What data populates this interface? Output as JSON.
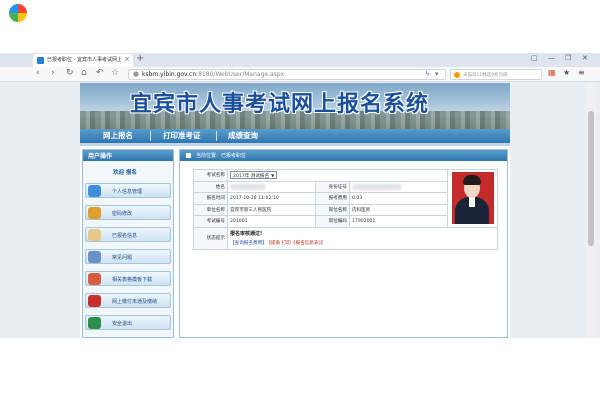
{
  "browser": {
    "tab": {
      "title": "已报考职位 - 宜宾市人事考试网上报名系统",
      "close": "×"
    },
    "new_tab": "+",
    "window_controls": {
      "menu": "▢",
      "minimize": "—",
      "restore": "❐",
      "close": "✕"
    },
    "nav": {
      "back": "‹",
      "forward": "›",
      "reload": "↻",
      "home": "⌂",
      "undo": "↶",
      "favorite": "☆"
    },
    "address": {
      "host": "ksbm.yibin.gov.cn",
      "path": ":8180/WebUser/Manage.aspx"
    },
    "address_icons": {
      "lightning": "ϟ",
      "dropdown": "▾"
    },
    "search": {
      "placeholder": "天猫双11精选9折包邮"
    },
    "toolbar_icons": {
      "apps": "▦",
      "star": "★",
      "menu": "≡"
    }
  },
  "site": {
    "banner_title": "宜宾市人事考试网上报名系统",
    "main_nav": [
      "网上报名",
      "打印准考证",
      "成绩查询"
    ]
  },
  "sidebar": {
    "header": "用户操作",
    "welcome": "欢迎 报名",
    "items": [
      {
        "label": "个人信息管理",
        "color": "#3f8ed8"
      },
      {
        "label": "密码修改",
        "color": "#e0a030"
      },
      {
        "label": "已报名信息",
        "color": "#e6c98a"
      },
      {
        "label": "常见问题",
        "color": "#6b8fc9"
      },
      {
        "label": "相关表格模板下载",
        "color": "#d95c40"
      },
      {
        "label": "网上缴付未通及缴纳",
        "color": "#c9302c"
      },
      {
        "label": "安全退出",
        "color": "#2d8f4e"
      }
    ]
  },
  "content": {
    "breadcrumb": "当前位置：已报考职位",
    "exam_label": "考试名称",
    "exam_value": "2017年 测试报名",
    "exam_dropdown": "▼",
    "rows": [
      {
        "k1": "姓名",
        "v1": "",
        "k2": "身份证号",
        "v2": ""
      },
      {
        "k1": "报名时间",
        "v1": "2017-10-28 11:02:10",
        "k2": "报考费用",
        "v2": "0.03"
      },
      {
        "k1": "单位名称",
        "v1": "宜宾市第三人民医院",
        "k2": "岗位名称",
        "v2": "内科医师"
      },
      {
        "k1": "考试编号",
        "v1": "201001",
        "k2": "岗位编码",
        "v2": "17902001"
      }
    ],
    "status_label": "状态提示",
    "status_ok": "报名审核通过!",
    "link_pay": "【查询报名费用】",
    "link_print": "【提备 打印《报名信息表》】"
  }
}
